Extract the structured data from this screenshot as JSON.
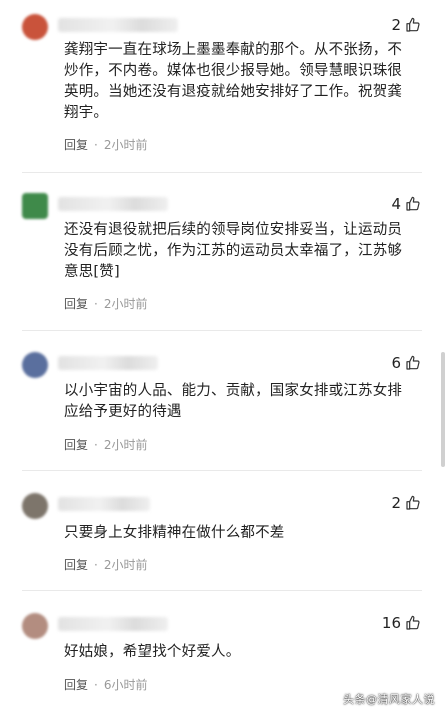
{
  "comments": [
    {
      "likes": "2",
      "text": "龚翔宇一直在球场上墨墨奉献的那个。从不张扬，不炒作，不内卷。媒体也很少报导她。领导慧眼识珠很英明。当她还没有退疫就给她安排好了工作。祝贺龚翔宇。",
      "reply_label": "回复",
      "time": "2小时前",
      "avatar_color": "#c9533b"
    },
    {
      "likes": "4",
      "text": "还没有退役就把后续的领导岗位安排妥当，让运动员没有后顾之忧，作为江苏的运动员太幸福了，江苏够意思[赞]",
      "reply_label": "回复",
      "time": "2小时前",
      "avatar_color": "#3f8a4a"
    },
    {
      "likes": "6",
      "text": "以小宇宙的人品、能力、贡献，国家女排或江苏女排应给予更好的待遇",
      "reply_label": "回复",
      "time": "2小时前",
      "avatar_color": "#5a6f9e"
    },
    {
      "likes": "2",
      "text": "只要身上女排精神在做什么都不差",
      "reply_label": "回复",
      "time": "2小时前",
      "avatar_color": "#7d756b"
    },
    {
      "likes": "16",
      "text": "好姑娘，希望找个好爱人。",
      "reply_label": "回复",
      "time": "6小时前",
      "avatar_color": "#b38d80"
    }
  ],
  "watermark": "头条@清风家人说",
  "icons": {
    "like": "thumbs-up-icon"
  }
}
